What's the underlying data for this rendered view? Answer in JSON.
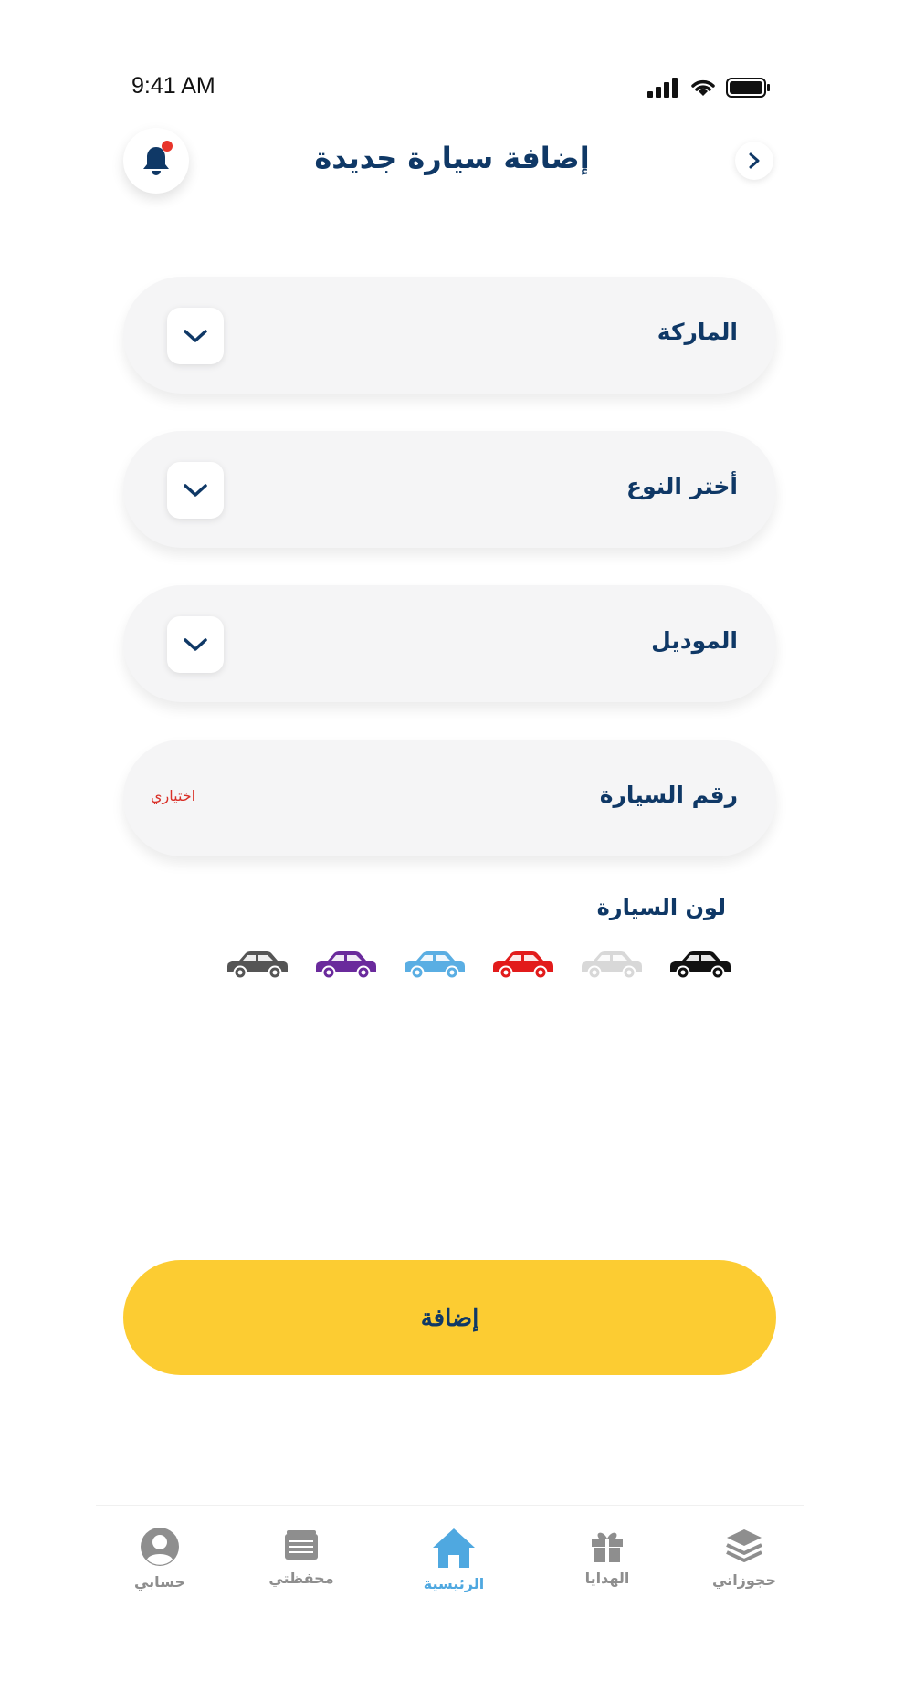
{
  "status_bar": {
    "time": "9:41 AM"
  },
  "header": {
    "title": "إضافة سيارة جديدة"
  },
  "form": {
    "brand_label": "الماركة",
    "type_label": "أختر النوع",
    "model_label": "الموديل",
    "plate_label": "رقم السيارة",
    "plate_optional": "اختياري",
    "color_label": "لون السيارة"
  },
  "car_colors": [
    "#555555",
    "#6a2a9c",
    "#5aaee3",
    "#e21b1b",
    "#d8d8d8",
    "#111111"
  ],
  "submit_label": "إضافة",
  "tabbar": {
    "account": "حسابي",
    "wallet": "محفظتي",
    "home": "الرئيسية",
    "gifts": "الهدايا",
    "bookings": "حجوزاتي"
  },
  "colors": {
    "primary": "#0f3866",
    "accent": "#fccc32",
    "active_tab": "#4fa8e0",
    "notice_dot": "#e8352b"
  }
}
